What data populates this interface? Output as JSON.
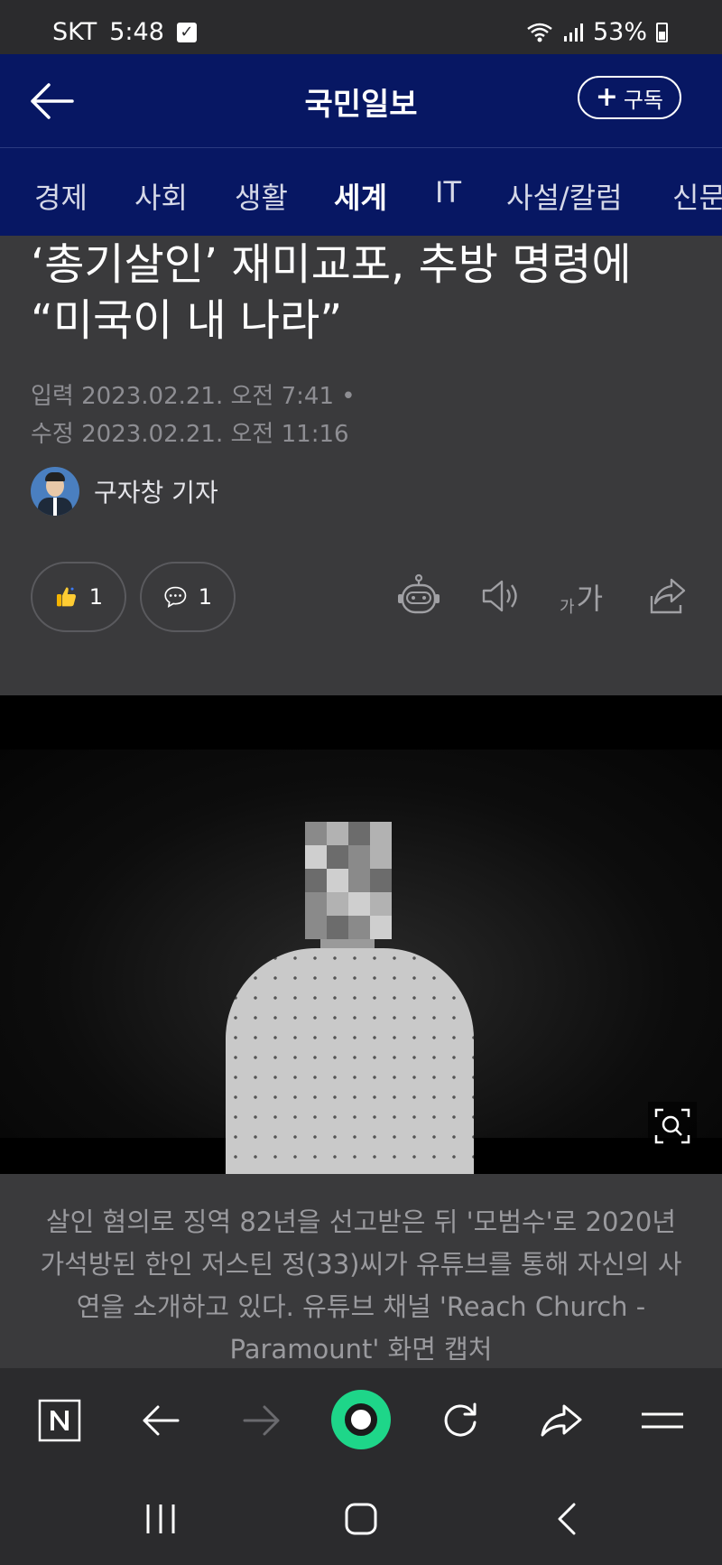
{
  "status_bar": {
    "carrier": "SKT",
    "time": "5:48",
    "battery": "53%"
  },
  "header": {
    "title": "국민일보",
    "subscribe_label": "구독"
  },
  "tabs": [
    {
      "label": "경제"
    },
    {
      "label": "사회"
    },
    {
      "label": "생활"
    },
    {
      "label": "세계"
    },
    {
      "label": "IT"
    },
    {
      "label": "사설/칼럼"
    },
    {
      "label": "신문"
    }
  ],
  "active_tab": "세계",
  "article": {
    "headline": "‘총기살인’ 재미교포, 추방 명령에 “미국이 내 나라”",
    "input_label": "입력",
    "input_date": "2023.02.21. 오전 7:41",
    "modified_label": "수정",
    "modified_date": "2023.02.21. 오전 11:16",
    "reporter": "구자창 기자",
    "like_count": "1",
    "comment_count": "1",
    "font_small": "가",
    "font_big": "가",
    "caption": "살인 혐의로 징역 82년을 선고받은 뒤 '모범수'로 2020년 가석방된 한인 저스틴 정(33)씨가 유튜브를 통해 자신의 사연을 소개하고 있다. 유튜브 채널 'Reach Church - Paramount' 화면 캡처"
  },
  "colors": {
    "header_bg": "#071763",
    "page_bg": "#3a3a3c",
    "accent_green": "#1ed689"
  },
  "icons": [
    "check-icon",
    "wifi-icon",
    "signal-icon",
    "battery-icon",
    "back-arrow-icon",
    "plus-icon",
    "thumbs-up-icon",
    "comment-icon",
    "robot-icon",
    "speaker-icon",
    "font-size-icon",
    "share-icon",
    "zoom-icon",
    "naver-icon",
    "browser-back-icon",
    "browser-forward-icon",
    "green-home-icon",
    "refresh-icon",
    "browser-share-icon",
    "menu-icon",
    "recent-apps-icon",
    "system-home-icon",
    "system-back-icon"
  ]
}
